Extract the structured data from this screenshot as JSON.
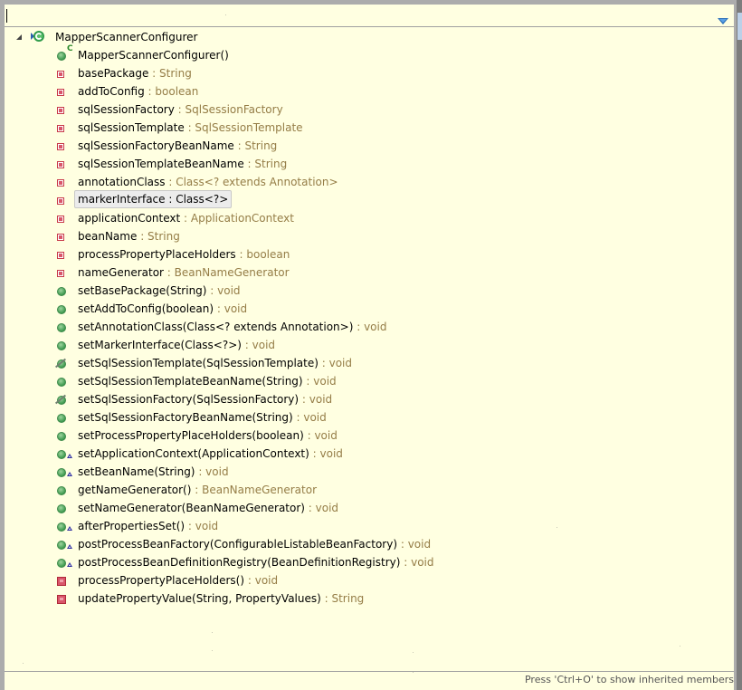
{
  "filter": {
    "value": "",
    "placeholder": ""
  },
  "menu": {
    "icon": "view-menu-triangle-icon"
  },
  "tree": {
    "root": {
      "label": "MapperScannerConfigurer",
      "icon": "class-icon",
      "expanded": true
    },
    "members": [
      {
        "kind": "constructor",
        "name": "MapperScannerConfigurer()",
        "type": "",
        "icon": "public-constructor-icon"
      },
      {
        "kind": "field",
        "name": "basePackage",
        "type": "String",
        "icon": "private-field-icon"
      },
      {
        "kind": "field",
        "name": "addToConfig",
        "type": "boolean",
        "icon": "private-field-icon"
      },
      {
        "kind": "field",
        "name": "sqlSessionFactory",
        "type": "SqlSessionFactory",
        "icon": "private-field-icon"
      },
      {
        "kind": "field",
        "name": "sqlSessionTemplate",
        "type": "SqlSessionTemplate",
        "icon": "private-field-icon"
      },
      {
        "kind": "field",
        "name": "sqlSessionFactoryBeanName",
        "type": "String",
        "icon": "private-field-icon"
      },
      {
        "kind": "field",
        "name": "sqlSessionTemplateBeanName",
        "type": "String",
        "icon": "private-field-icon"
      },
      {
        "kind": "field",
        "name": "annotationClass",
        "type": "Class<? extends Annotation>",
        "icon": "private-field-icon"
      },
      {
        "kind": "field",
        "name": "markerInterface",
        "type": "Class<?>",
        "icon": "private-field-icon",
        "selected": true
      },
      {
        "kind": "field",
        "name": "applicationContext",
        "type": "ApplicationContext",
        "icon": "private-field-icon"
      },
      {
        "kind": "field",
        "name": "beanName",
        "type": "String",
        "icon": "private-field-icon"
      },
      {
        "kind": "field",
        "name": "processPropertyPlaceHolders",
        "type": "boolean",
        "icon": "private-field-icon"
      },
      {
        "kind": "field",
        "name": "nameGenerator",
        "type": "BeanNameGenerator",
        "icon": "private-field-icon"
      },
      {
        "kind": "method",
        "name": "setBasePackage(String)",
        "type": "void",
        "icon": "public-method-icon"
      },
      {
        "kind": "method",
        "name": "setAddToConfig(boolean)",
        "type": "void",
        "icon": "public-method-icon"
      },
      {
        "kind": "method",
        "name": "setAnnotationClass(Class<? extends Annotation>)",
        "type": "void",
        "icon": "public-method-icon"
      },
      {
        "kind": "method",
        "name": "setMarkerInterface(Class<?>)",
        "type": "void",
        "icon": "public-method-icon"
      },
      {
        "kind": "method",
        "name": "setSqlSessionTemplate(SqlSessionTemplate)",
        "type": "void",
        "icon": "deprecated-public-method-icon"
      },
      {
        "kind": "method",
        "name": "setSqlSessionTemplateBeanName(String)",
        "type": "void",
        "icon": "public-method-icon"
      },
      {
        "kind": "method",
        "name": "setSqlSessionFactory(SqlSessionFactory)",
        "type": "void",
        "icon": "deprecated-public-method-icon"
      },
      {
        "kind": "method",
        "name": "setSqlSessionFactoryBeanName(String)",
        "type": "void",
        "icon": "public-method-icon"
      },
      {
        "kind": "method",
        "name": "setProcessPropertyPlaceHolders(boolean)",
        "type": "void",
        "icon": "public-method-icon"
      },
      {
        "kind": "method",
        "name": "setApplicationContext(ApplicationContext)",
        "type": "void",
        "icon": "implements-method-icon"
      },
      {
        "kind": "method",
        "name": "setBeanName(String)",
        "type": "void",
        "icon": "implements-method-icon"
      },
      {
        "kind": "method",
        "name": "getNameGenerator()",
        "type": "BeanNameGenerator",
        "icon": "public-method-icon"
      },
      {
        "kind": "method",
        "name": "setNameGenerator(BeanNameGenerator)",
        "type": "void",
        "icon": "public-method-icon"
      },
      {
        "kind": "method",
        "name": "afterPropertiesSet()",
        "type": "void",
        "icon": "implements-method-icon"
      },
      {
        "kind": "method",
        "name": "postProcessBeanFactory(ConfigurableListableBeanFactory)",
        "type": "void",
        "icon": "implements-method-icon"
      },
      {
        "kind": "method",
        "name": "postProcessBeanDefinitionRegistry(BeanDefinitionRegistry)",
        "type": "void",
        "icon": "implements-method-icon"
      },
      {
        "kind": "method",
        "name": "processPropertyPlaceHolders()",
        "type": "void",
        "icon": "private-method-icon"
      },
      {
        "kind": "method",
        "name": "updatePropertyValue(String, PropertyValues)",
        "type": "String",
        "icon": "private-method-icon"
      }
    ]
  },
  "status": {
    "text": "Press 'Ctrl+O' to show inherited members"
  },
  "colors": {
    "background": "#ffffe1",
    "type_text": "#957d47",
    "field_icon": "#d9566a",
    "method_icon": "#3f9a4f",
    "override_icon": "#3030a0"
  }
}
